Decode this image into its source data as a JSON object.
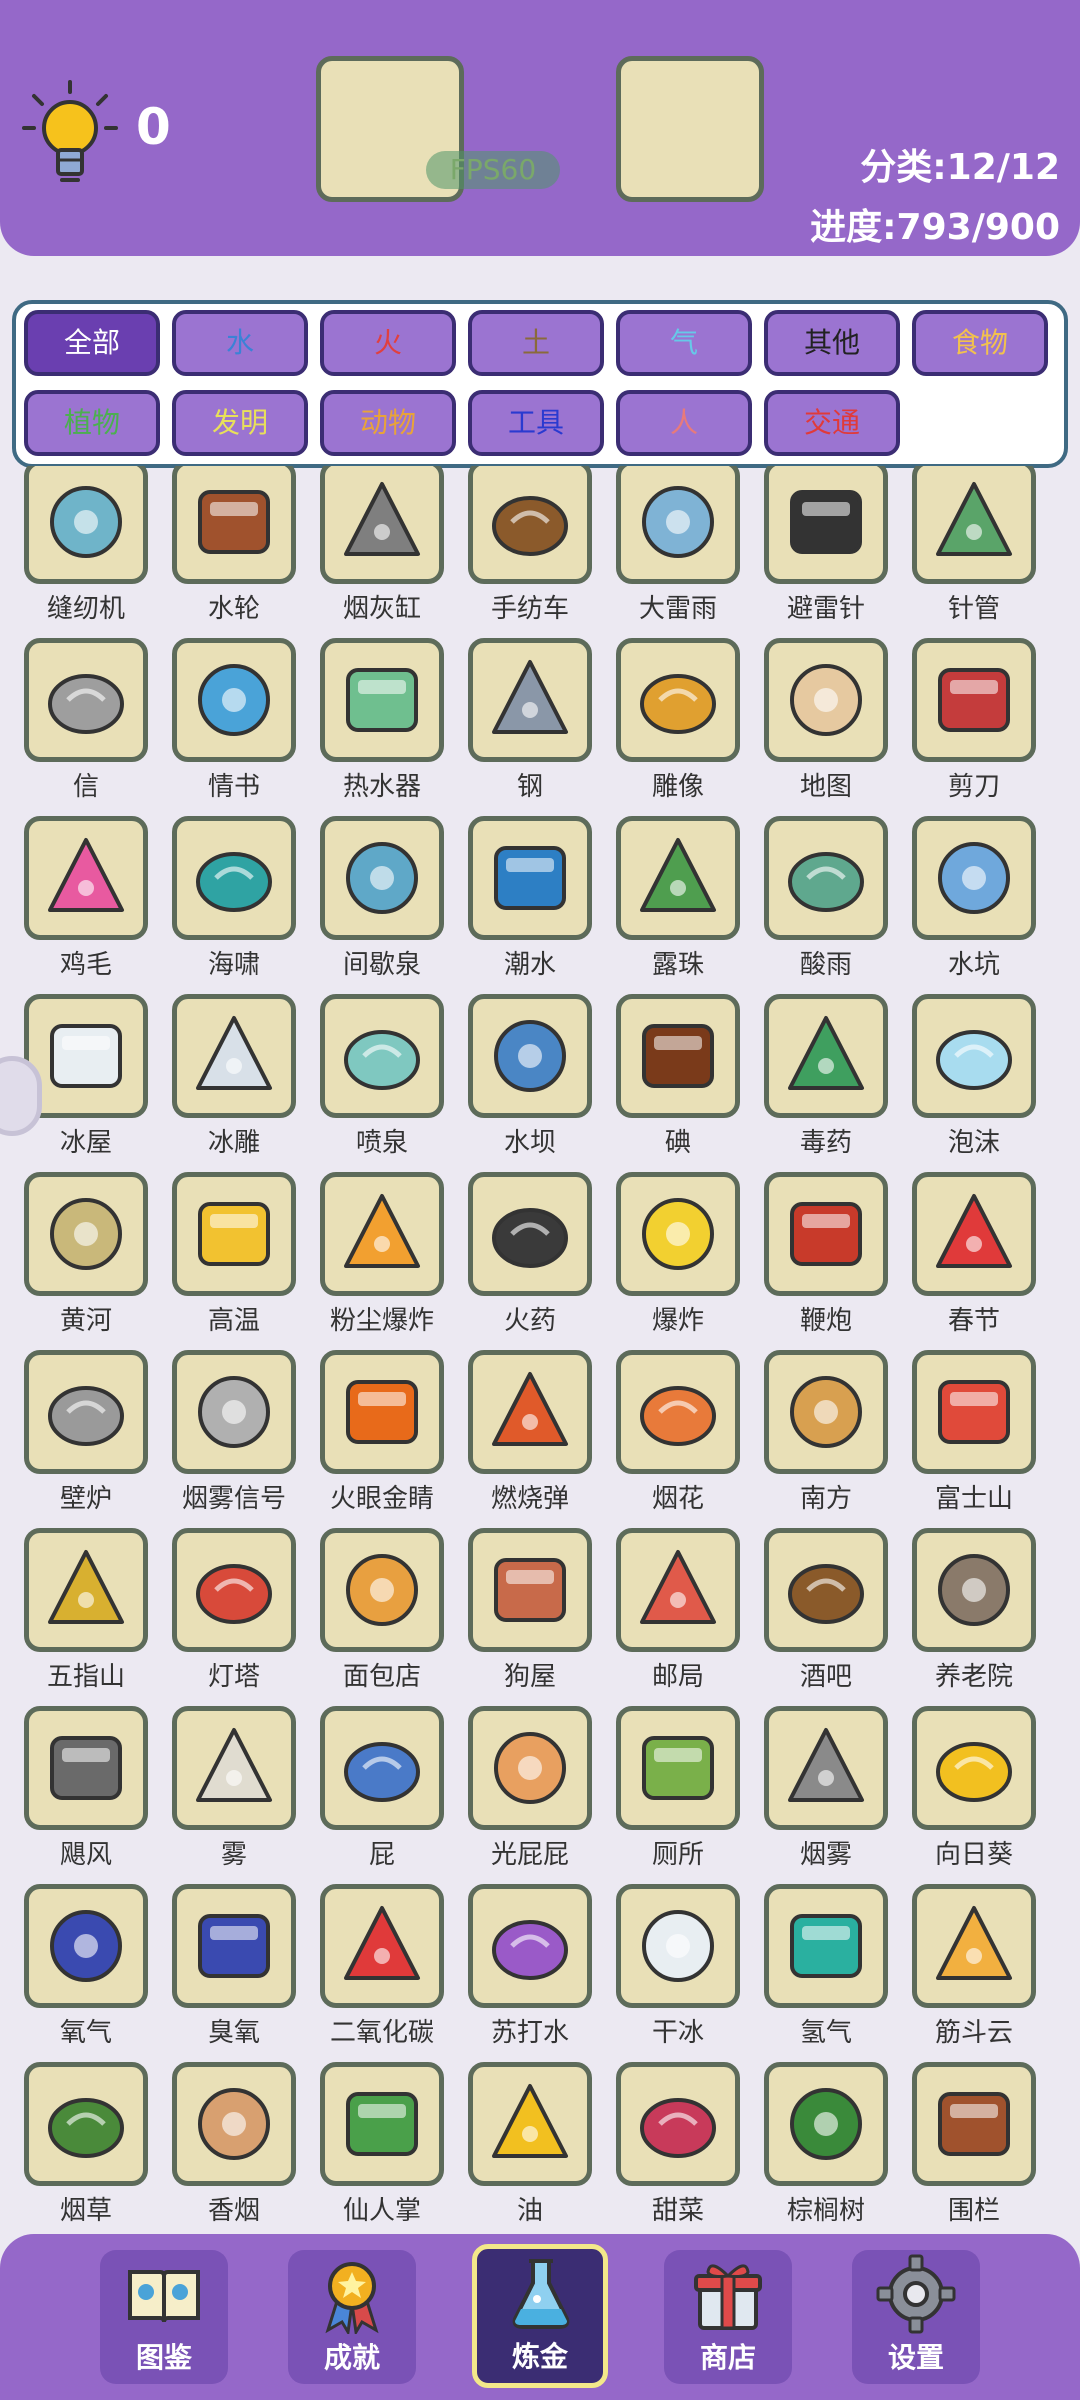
{
  "header": {
    "score": "0",
    "fps": "FPS60",
    "category": "分类:12/12",
    "progress": "进度:793/900"
  },
  "filters": [
    {
      "label": "全部",
      "color": "#ffffff"
    },
    {
      "label": "水",
      "color": "#3b82d6"
    },
    {
      "label": "火",
      "color": "#e04040"
    },
    {
      "label": "土",
      "color": "#8a6a3a"
    },
    {
      "label": "气",
      "color": "#66c9e8"
    },
    {
      "label": "其他",
      "color": "#222222"
    },
    {
      "label": "食物",
      "color": "#f2c14e"
    },
    {
      "label": "植物",
      "color": "#4caf50"
    },
    {
      "label": "发明",
      "color": "#e8e05a"
    },
    {
      "label": "动物",
      "color": "#e8a33a"
    },
    {
      "label": "工具",
      "color": "#2a3ad0"
    },
    {
      "label": "人",
      "color": "#e87a7a"
    },
    {
      "label": "交通",
      "color": "#e03a3a"
    }
  ],
  "items": [
    {
      "label": "缝纫机",
      "icon": "sewing-machine-icon",
      "color": "#6fb4c9"
    },
    {
      "label": "水轮",
      "icon": "water-wheel-icon",
      "color": "#a0522d"
    },
    {
      "label": "烟灰缸",
      "icon": "ashtray-icon",
      "color": "#7f7f7f"
    },
    {
      "label": "手纺车",
      "icon": "spinning-wheel-icon",
      "color": "#8b5a2b"
    },
    {
      "label": "大雷雨",
      "icon": "thunderstorm-icon",
      "color": "#7fb3d5"
    },
    {
      "label": "避雷针",
      "icon": "lightning-rod-icon",
      "color": "#333333"
    },
    {
      "label": "针管",
      "icon": "syringe-icon",
      "color": "#5aa469"
    },
    {
      "label": "信",
      "icon": "envelope-icon",
      "color": "#9e9e9e"
    },
    {
      "label": "情书",
      "icon": "love-letter-icon",
      "color": "#4aa3d8"
    },
    {
      "label": "热水器",
      "icon": "water-heater-icon",
      "color": "#6fbf8f"
    },
    {
      "label": "钢",
      "icon": "steel-pipes-icon",
      "color": "#8a97a8"
    },
    {
      "label": "雕像",
      "icon": "statue-icon",
      "color": "#e0a030"
    },
    {
      "label": "地图",
      "icon": "map-icon",
      "color": "#e6c9a0"
    },
    {
      "label": "剪刀",
      "icon": "scissors-icon",
      "color": "#c43c3c"
    },
    {
      "label": "鸡毛",
      "icon": "feather-icon",
      "color": "#e85aa0"
    },
    {
      "label": "海啸",
      "icon": "tsunami-icon",
      "color": "#2fa3a3"
    },
    {
      "label": "间歇泉",
      "icon": "geyser-icon",
      "color": "#5fa8c8"
    },
    {
      "label": "潮水",
      "icon": "tide-icon",
      "color": "#2d7fc4"
    },
    {
      "label": "露珠",
      "icon": "dew-icon",
      "color": "#4f9e4f"
    },
    {
      "label": "酸雨",
      "icon": "acid-rain-icon",
      "color": "#5fa88e"
    },
    {
      "label": "水坑",
      "icon": "puddle-icon",
      "color": "#6fa8dc"
    },
    {
      "label": "冰屋",
      "icon": "igloo-icon",
      "color": "#e8eef2"
    },
    {
      "label": "冰雕",
      "icon": "ice-sculpture-icon",
      "color": "#d8e0e8"
    },
    {
      "label": "喷泉",
      "icon": "fountain-icon",
      "color": "#7fc8c0"
    },
    {
      "label": "水坝",
      "icon": "dam-icon",
      "color": "#4a86c5"
    },
    {
      "label": "碘",
      "icon": "iodine-bottle-icon",
      "color": "#7a3a1a"
    },
    {
      "label": "毒药",
      "icon": "poison-icon",
      "color": "#3f9f5f"
    },
    {
      "label": "泡沫",
      "icon": "foam-icon",
      "color": "#a8dcef"
    },
    {
      "label": "黄河",
      "icon": "yellow-river-icon",
      "color": "#c9b87a"
    },
    {
      "label": "高温",
      "icon": "heat-icon",
      "color": "#f2c230"
    },
    {
      "label": "粉尘爆炸",
      "icon": "dust-explosion-icon",
      "color": "#f2a030"
    },
    {
      "label": "火药",
      "icon": "gunpowder-icon",
      "color": "#3a3a3a"
    },
    {
      "label": "爆炸",
      "icon": "explosion-icon",
      "color": "#f2d030"
    },
    {
      "label": "鞭炮",
      "icon": "firecracker-icon",
      "color": "#c83a2a"
    },
    {
      "label": "春节",
      "icon": "spring-festival-icon",
      "color": "#e03a3a"
    },
    {
      "label": "壁炉",
      "icon": "fireplace-icon",
      "color": "#9a9a9a"
    },
    {
      "label": "烟雾信号",
      "icon": "smoke-signal-icon",
      "color": "#b0b0b0"
    },
    {
      "label": "火眼金睛",
      "icon": "fiery-eyes-icon",
      "color": "#e86a1a"
    },
    {
      "label": "燃烧弹",
      "icon": "molotov-icon",
      "color": "#e05a2a"
    },
    {
      "label": "烟花",
      "icon": "fireworks-icon",
      "color": "#e87a3a"
    },
    {
      "label": "南方",
      "icon": "south-temple-icon",
      "color": "#d8a050"
    },
    {
      "label": "富士山",
      "icon": "mount-fuji-icon",
      "color": "#e04a3a"
    },
    {
      "label": "五指山",
      "icon": "five-finger-mountain-icon",
      "color": "#d8b030"
    },
    {
      "label": "灯塔",
      "icon": "lighthouse-icon",
      "color": "#d84a3a"
    },
    {
      "label": "面包店",
      "icon": "bakery-icon",
      "color": "#e8a040"
    },
    {
      "label": "狗屋",
      "icon": "doghouse-icon",
      "color": "#c86a4a"
    },
    {
      "label": "邮局",
      "icon": "post-office-icon",
      "color": "#e05a4a"
    },
    {
      "label": "酒吧",
      "icon": "bar-icon",
      "color": "#8a5a2a"
    },
    {
      "label": "养老院",
      "icon": "nursing-home-icon",
      "color": "#8a7a6a"
    },
    {
      "label": "飓风",
      "icon": "hurricane-icon",
      "color": "#6a6a6a"
    },
    {
      "label": "雾",
      "icon": "fog-icon",
      "color": "#e0dcd0"
    },
    {
      "label": "屁",
      "icon": "fart-icon",
      "color": "#4a7ac8"
    },
    {
      "label": "光屁屁",
      "icon": "bare-bottom-icon",
      "color": "#e8a060"
    },
    {
      "label": "厕所",
      "icon": "toilet-icon",
      "color": "#7ab04a"
    },
    {
      "label": "烟雾",
      "icon": "smoke-icon",
      "color": "#8a8a8a"
    },
    {
      "label": "向日葵",
      "icon": "sunflower-icon",
      "color": "#f2c020"
    },
    {
      "label": "氧气",
      "icon": "oxygen-molecule-icon",
      "color": "#3a4ab0"
    },
    {
      "label": "臭氧",
      "icon": "ozone-molecule-icon",
      "color": "#3a4ab0"
    },
    {
      "label": "二氧化碳",
      "icon": "co2-molecule-icon",
      "color": "#e03a3a"
    },
    {
      "label": "苏打水",
      "icon": "soda-icon",
      "color": "#9a5ac8"
    },
    {
      "label": "干冰",
      "icon": "dry-ice-icon",
      "color": "#e8eef2"
    },
    {
      "label": "氢气",
      "icon": "hydrogen-molecule-icon",
      "color": "#2ab0a0"
    },
    {
      "label": "筋斗云",
      "icon": "somersault-cloud-icon",
      "color": "#f2b040"
    },
    {
      "label": "烟草",
      "icon": "tobacco-leaf-icon",
      "color": "#4a8a3a"
    },
    {
      "label": "香烟",
      "icon": "cigarette-icon",
      "color": "#d8a070"
    },
    {
      "label": "仙人掌",
      "icon": "cactus-icon",
      "color": "#4aa04a"
    },
    {
      "label": "油",
      "icon": "oil-bottle-icon",
      "color": "#f2c020"
    },
    {
      "label": "甜菜",
      "icon": "beet-icon",
      "color": "#c83a5a"
    },
    {
      "label": "棕榈树",
      "icon": "palm-tree-icon",
      "color": "#3a8a3a"
    },
    {
      "label": "围栏",
      "icon": "fence-icon",
      "color": "#a0522d"
    }
  ],
  "nav": [
    {
      "label": "图鉴",
      "icon": "encyclopedia-book-icon"
    },
    {
      "label": "成就",
      "icon": "achievement-medal-icon"
    },
    {
      "label": "炼金",
      "icon": "alchemy-flask-icon"
    },
    {
      "label": "商店",
      "icon": "shop-gift-icon"
    },
    {
      "label": "设置",
      "icon": "settings-gear-icon"
    }
  ]
}
